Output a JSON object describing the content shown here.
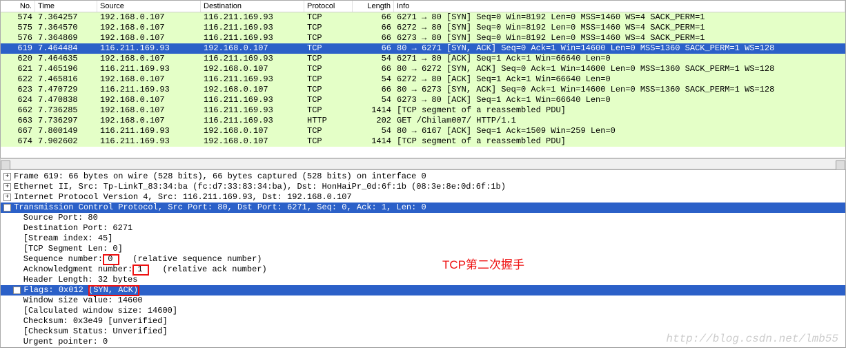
{
  "columns": {
    "no": "No.",
    "time": "Time",
    "src": "Source",
    "dst": "Destination",
    "prot": "Protocol",
    "len": "Length",
    "info": "Info"
  },
  "packets": [
    {
      "no": "574",
      "time": "7.364257",
      "src": "192.168.0.107",
      "dst": "116.211.169.93",
      "prot": "TCP",
      "len": "66",
      "info": "6271 → 80 [SYN] Seq=0 Win=8192 Len=0 MSS=1460 WS=4 SACK_PERM=1",
      "sel": false
    },
    {
      "no": "575",
      "time": "7.364570",
      "src": "192.168.0.107",
      "dst": "116.211.169.93",
      "prot": "TCP",
      "len": "66",
      "info": "6272 → 80 [SYN] Seq=0 Win=8192 Len=0 MSS=1460 WS=4 SACK_PERM=1",
      "sel": false
    },
    {
      "no": "576",
      "time": "7.364869",
      "src": "192.168.0.107",
      "dst": "116.211.169.93",
      "prot": "TCP",
      "len": "66",
      "info": "6273 → 80 [SYN] Seq=0 Win=8192 Len=0 MSS=1460 WS=4 SACK_PERM=1",
      "sel": false
    },
    {
      "no": "619",
      "time": "7.464484",
      "src": "116.211.169.93",
      "dst": "192.168.0.107",
      "prot": "TCP",
      "len": "66",
      "info": "80 → 6271 [SYN, ACK] Seq=0 Ack=1 Win=14600 Len=0 MSS=1360 SACK_PERM=1 WS=128",
      "sel": true
    },
    {
      "no": "620",
      "time": "7.464635",
      "src": "192.168.0.107",
      "dst": "116.211.169.93",
      "prot": "TCP",
      "len": "54",
      "info": "6271 → 80 [ACK] Seq=1 Ack=1 Win=66640 Len=0",
      "sel": false
    },
    {
      "no": "621",
      "time": "7.465196",
      "src": "116.211.169.93",
      "dst": "192.168.0.107",
      "prot": "TCP",
      "len": "66",
      "info": "80 → 6272 [SYN, ACK] Seq=0 Ack=1 Win=14600 Len=0 MSS=1360 SACK_PERM=1 WS=128",
      "sel": false
    },
    {
      "no": "622",
      "time": "7.465816",
      "src": "192.168.0.107",
      "dst": "116.211.169.93",
      "prot": "TCP",
      "len": "54",
      "info": "6272 → 80 [ACK] Seq=1 Ack=1 Win=66640 Len=0",
      "sel": false
    },
    {
      "no": "623",
      "time": "7.470729",
      "src": "116.211.169.93",
      "dst": "192.168.0.107",
      "prot": "TCP",
      "len": "66",
      "info": "80 → 6273 [SYN, ACK] Seq=0 Ack=1 Win=14600 Len=0 MSS=1360 SACK_PERM=1 WS=128",
      "sel": false
    },
    {
      "no": "624",
      "time": "7.470838",
      "src": "192.168.0.107",
      "dst": "116.211.169.93",
      "prot": "TCP",
      "len": "54",
      "info": "6273 → 80 [ACK] Seq=1 Ack=1 Win=66640 Len=0",
      "sel": false
    },
    {
      "no": "662",
      "time": "7.736285",
      "src": "192.168.0.107",
      "dst": "116.211.169.93",
      "prot": "TCP",
      "len": "1414",
      "info": "[TCP segment of a reassembled PDU]",
      "sel": false
    },
    {
      "no": "663",
      "time": "7.736297",
      "src": "192.168.0.107",
      "dst": "116.211.169.93",
      "prot": "HTTP",
      "len": "202",
      "info": "GET /Chilam007/ HTTP/1.1",
      "sel": false
    },
    {
      "no": "667",
      "time": "7.800149",
      "src": "116.211.169.93",
      "dst": "192.168.0.107",
      "prot": "TCP",
      "len": "54",
      "info": "80 → 6167 [ACK] Seq=1 Ack=1509 Win=259 Len=0",
      "sel": false
    },
    {
      "no": "674",
      "time": "7.902602",
      "src": "116.211.169.93",
      "dst": "192.168.0.107",
      "prot": "TCP",
      "len": "1414",
      "info": "[TCP segment of a reassembled PDU]",
      "sel": false
    }
  ],
  "details": {
    "frame": "Frame 619: 66 bytes on wire (528 bits), 66 bytes captured (528 bits) on interface 0",
    "eth": "Ethernet II, Src: Tp-LinkT_83:34:ba (fc:d7:33:83:34:ba), Dst: HonHaiPr_0d:6f:1b (08:3e:8e:0d:6f:1b)",
    "ip": "Internet Protocol Version 4, Src: 116.211.169.93, Dst: 192.168.0.107",
    "tcp": "Transmission Control Protocol, Src Port: 80, Dst Port: 6271, Seq: 0, Ack: 1, Len: 0",
    "srcport": "    Source Port: 80",
    "dstport": "    Destination Port: 6271",
    "stream": "    [Stream index: 45]",
    "seglen": "    [TCP Segment Len: 0]",
    "seqnum_a": "    Sequence number:",
    "seqnum_v": " 0 ",
    "seqnum_b": "   (relative sequence number)",
    "acknum_a": "    Acknowledgment number:",
    "acknum_v": " 1 ",
    "acknum_b": "   (relative ack number)",
    "hdrlen": "    Header Length: 32 bytes",
    "flags_a": "Flags: 0x012 ",
    "flags_b": "(SYN, ACK)",
    "winsize": "    Window size value: 14600",
    "calcwin": "    [Calculated window size: 14600]",
    "chksum": "    Checksum: 0x3e49 [unverified]",
    "chkstat": "    [Checksum Status: Unverified]",
    "urgptr": "    Urgent pointer: 0"
  },
  "annotation": "TCP第二次握手",
  "watermark": "http://blog.csdn.net/lmb55"
}
